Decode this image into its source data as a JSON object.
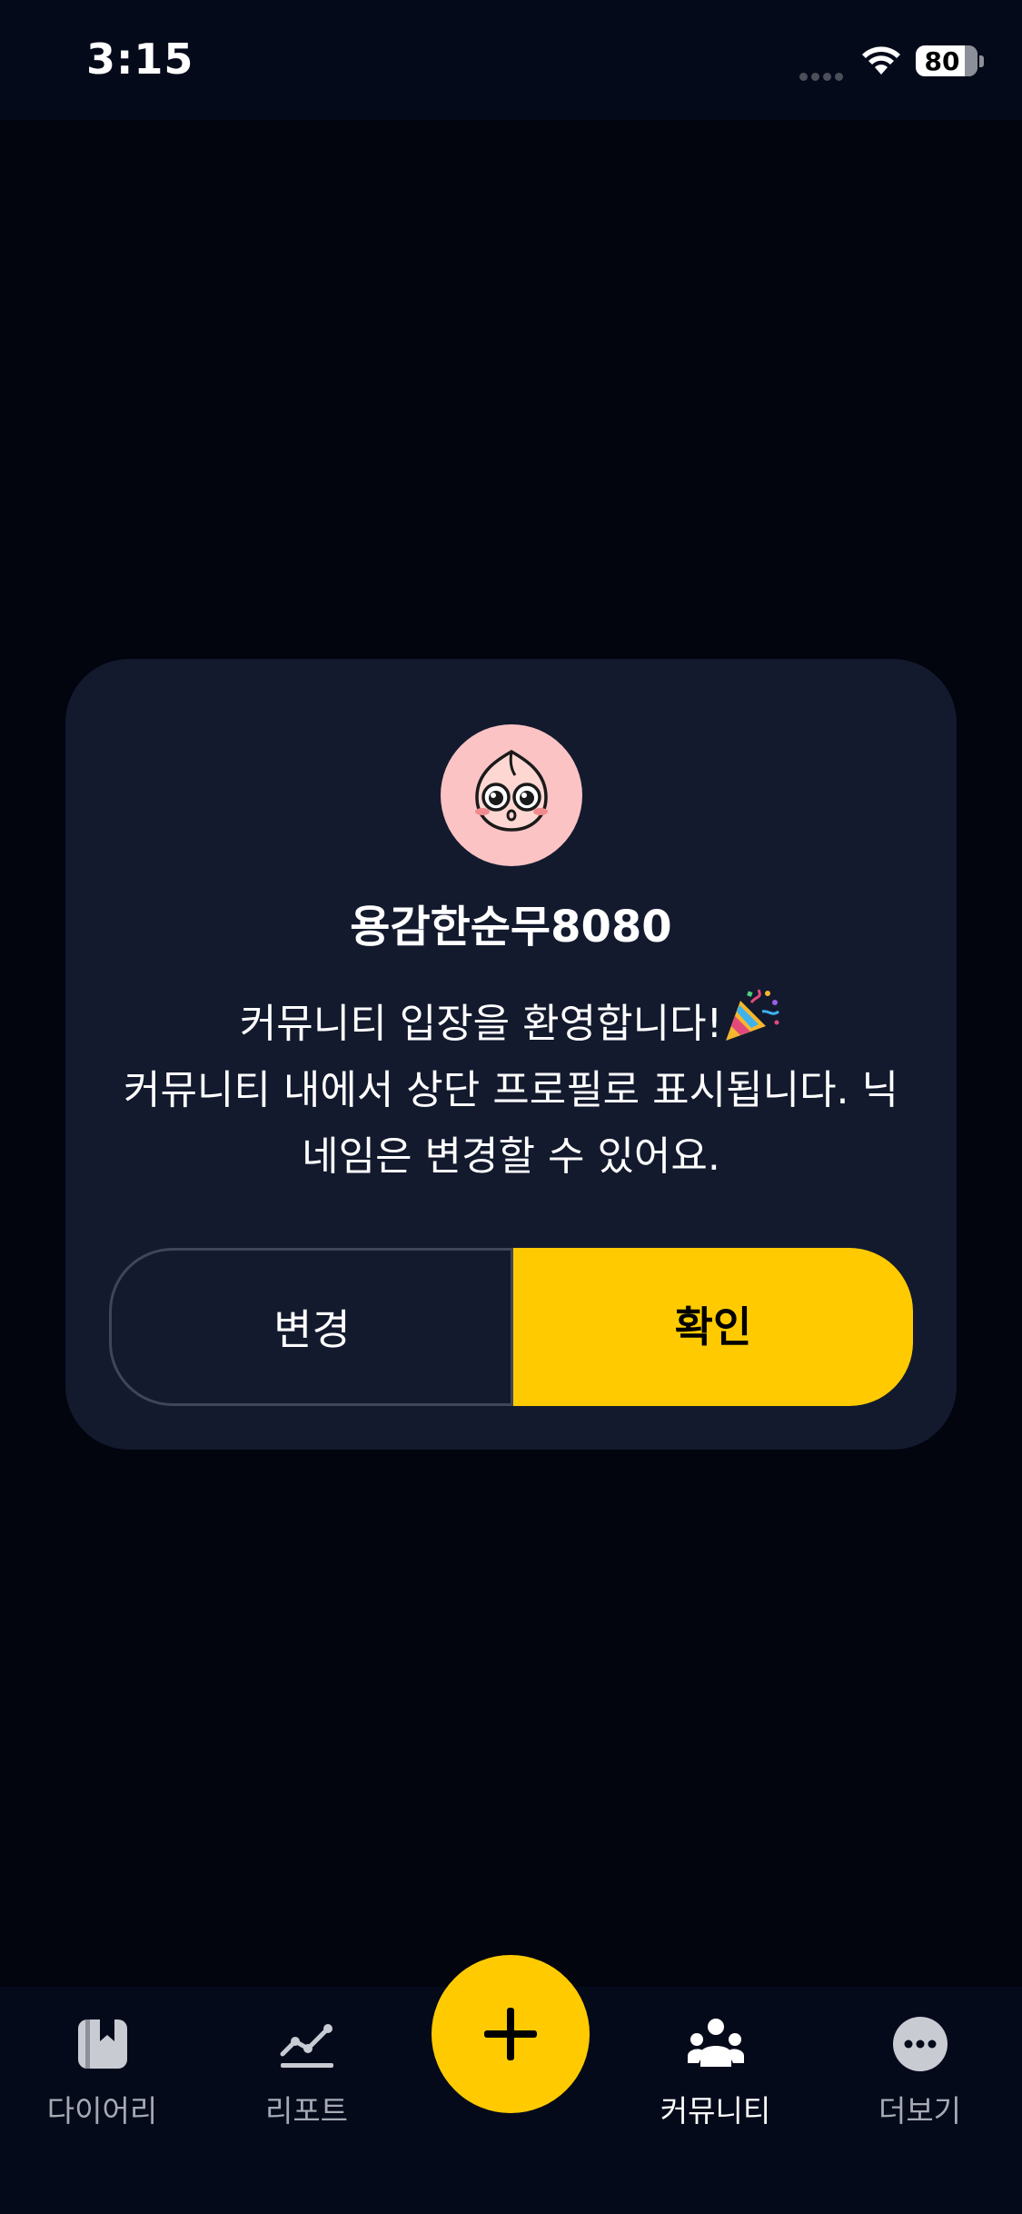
{
  "status_bar": {
    "time": "3:15",
    "battery": "80"
  },
  "dialog": {
    "nickname": "용감한순무8080",
    "message_line1": "커뮤니티 입장을 환영합니다!",
    "message_line2": "커뮤니티 내에서 상단 프로필로 표시됩니다. 닉",
    "message_line3": "네임은 변경할 수 있어요.",
    "change_button": "변경",
    "confirm_button": "확인",
    "avatar_icon": "peach-character-avatar",
    "party_icon": "party-popper-icon"
  },
  "tab_bar": {
    "items": [
      {
        "label": "다이어리",
        "icon": "diary-bookmark-icon",
        "active": false
      },
      {
        "label": "리포트",
        "icon": "line-chart-icon",
        "active": false
      },
      {
        "label": "커뮤니티",
        "icon": "community-people-icon",
        "active": true
      },
      {
        "label": "더보기",
        "icon": "more-dots-icon",
        "active": false
      }
    ],
    "add_button_icon": "plus-icon"
  },
  "colors": {
    "background": "#02040e",
    "dialog": "#131a2e",
    "accent": "#ffcb00",
    "tab_inactive": "#a6aab4"
  }
}
